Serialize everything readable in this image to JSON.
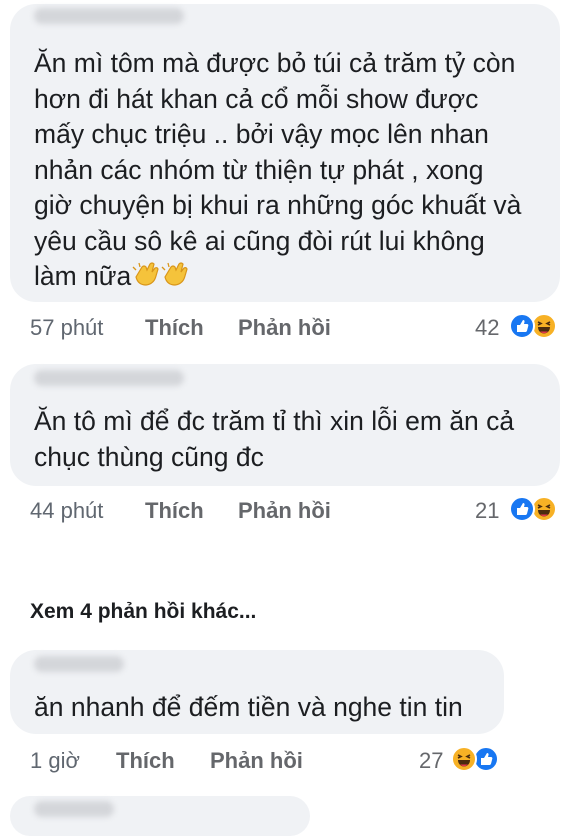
{
  "comments": [
    {
      "text": "Ăn mì tôm mà được bỏ túi cả trăm tỷ còn\nhơn đi hát khan  cả cổ mỗi show được\nmấy chục triệu .. bởi vậy mọc lên nhan\nnhản các nhóm từ thiện tự phát , xong\ngiờ chuyện bị khui ra những góc khuất và\nyêu cầu sô kê ai cũng đòi rút lui không\nlàm nữa",
      "emoji": [
        "clapping-hands",
        "clapping-hands"
      ],
      "time": "57 phút",
      "like": "Thích",
      "reply": "Phản hồi",
      "reaction_count": "42",
      "reactions": [
        "like",
        "haha"
      ]
    },
    {
      "text": "Ăn tô mì để đc trăm tỉ thì xin lỗi em ăn cả\nchục thùng cũng đc",
      "time": "44 phút",
      "like": "Thích",
      "reply": "Phản hồi",
      "reaction_count": "21",
      "reactions": [
        "like",
        "haha"
      ]
    },
    {
      "text": "ăn nhanh để đếm tiền và nghe tin tin",
      "time": "1 giờ",
      "like": "Thích",
      "reply": "Phản hồi",
      "reaction_count": "27",
      "reactions": [
        "haha",
        "like"
      ]
    }
  ],
  "more_replies": "Xem 4 phản hồi khác...",
  "colors": {
    "bubble": "#f0f2f5",
    "like_blue": "#1877f2",
    "haha_yellow": "#f7b125",
    "meta_gray": "#65676b"
  }
}
